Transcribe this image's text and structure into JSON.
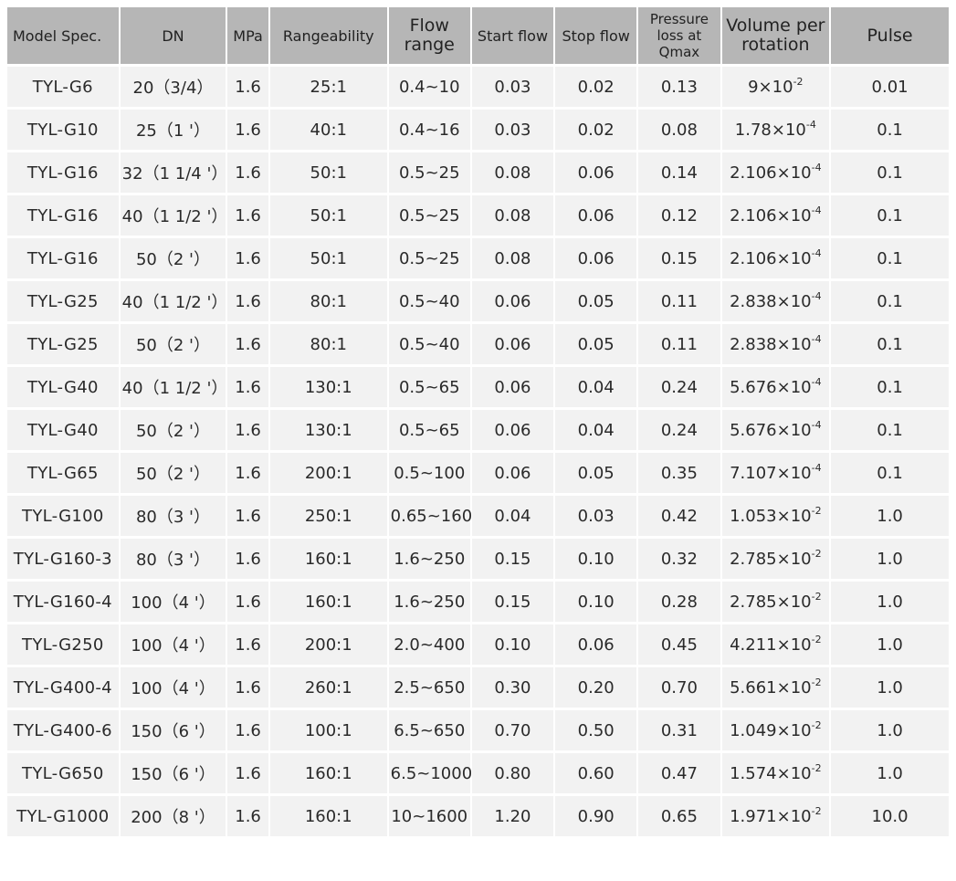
{
  "columns": [
    "Model Spec.",
    "DN",
    "MPa",
    "Rangeability",
    "Flow range",
    "Start flow",
    "Stop flow",
    "Pressure loss at Qmax",
    "Volume per rotation",
    "Pulse"
  ],
  "rows": [
    {
      "model": "TYL-G6",
      "dn": "20（3/4）",
      "mpa": "1.6",
      "range": "25:1",
      "flow": "0.4~10",
      "start": "0.03",
      "stop": "0.02",
      "loss": "0.13",
      "vol": "9×10",
      "exp": "-2",
      "pulse": "0.01"
    },
    {
      "model": "TYL-G10",
      "dn": "25（1 '）",
      "mpa": "1.6",
      "range": "40:1",
      "flow": "0.4~16",
      "start": "0.03",
      "stop": "0.02",
      "loss": "0.08",
      "vol": "1.78×10",
      "exp": "-4",
      "pulse": "0.1"
    },
    {
      "model": "TYL-G16",
      "dn": "32（1 1/4 '）",
      "mpa": "1.6",
      "range": "50:1",
      "flow": "0.5~25",
      "start": "0.08",
      "stop": "0.06",
      "loss": "0.14",
      "vol": "2.106×10",
      "exp": "-4",
      "pulse": "0.1"
    },
    {
      "model": "TYL-G16",
      "dn": "40（1 1/2 '）",
      "mpa": "1.6",
      "range": "50:1",
      "flow": "0.5~25",
      "start": "0.08",
      "stop": "0.06",
      "loss": "0.12",
      "vol": "2.106×10",
      "exp": "-4",
      "pulse": "0.1"
    },
    {
      "model": "TYL-G16",
      "dn": "50（2 '）",
      "mpa": "1.6",
      "range": "50:1",
      "flow": "0.5~25",
      "start": "0.08",
      "stop": "0.06",
      "loss": "0.15",
      "vol": "2.106×10",
      "exp": "-4",
      "pulse": "0.1"
    },
    {
      "model": "TYL-G25",
      "dn": "40（1 1/2 '）",
      "mpa": "1.6",
      "range": "80:1",
      "flow": "0.5~40",
      "start": "0.06",
      "stop": "0.05",
      "loss": "0.11",
      "vol": "2.838×10",
      "exp": "-4",
      "pulse": "0.1"
    },
    {
      "model": "TYL-G25",
      "dn": "50（2 '）",
      "mpa": "1.6",
      "range": "80:1",
      "flow": "0.5~40",
      "start": "0.06",
      "stop": "0.05",
      "loss": "0.11",
      "vol": "2.838×10",
      "exp": "-4",
      "pulse": "0.1"
    },
    {
      "model": "TYL-G40",
      "dn": "40（1 1/2 '）",
      "mpa": "1.6",
      "range": "130:1",
      "flow": "0.5~65",
      "start": "0.06",
      "stop": "0.04",
      "loss": "0.24",
      "vol": "5.676×10",
      "exp": "-4",
      "pulse": "0.1"
    },
    {
      "model": "TYL-G40",
      "dn": "50（2 '）",
      "mpa": "1.6",
      "range": "130:1",
      "flow": "0.5~65",
      "start": "0.06",
      "stop": "0.04",
      "loss": "0.24",
      "vol": "5.676×10",
      "exp": "-4",
      "pulse": "0.1"
    },
    {
      "model": "TYL-G65",
      "dn": "50（2 '）",
      "mpa": "1.6",
      "range": "200:1",
      "flow": "0.5~100",
      "start": "0.06",
      "stop": "0.05",
      "loss": "0.35",
      "vol": "7.107×10",
      "exp": "-4",
      "pulse": "0.1"
    },
    {
      "model": "TYL-G100",
      "dn": "80（3 '）",
      "mpa": "1.6",
      "range": "250:1",
      "flow": "0.65~160",
      "start": "0.04",
      "stop": "0.03",
      "loss": "0.42",
      "vol": "1.053×10",
      "exp": "-2",
      "pulse": "1.0"
    },
    {
      "model": "TYL-G160-3",
      "dn": "80（3 '）",
      "mpa": "1.6",
      "range": "160:1",
      "flow": "1.6~250",
      "start": "0.15",
      "stop": "0.10",
      "loss": "0.32",
      "vol": "2.785×10",
      "exp": "-2",
      "pulse": "1.0"
    },
    {
      "model": "TYL-G160-4",
      "dn": "100（4 '）",
      "mpa": "1.6",
      "range": "160:1",
      "flow": "1.6~250",
      "start": "0.15",
      "stop": "0.10",
      "loss": "0.28",
      "vol": "2.785×10",
      "exp": "-2",
      "pulse": "1.0"
    },
    {
      "model": "TYL-G250",
      "dn": "100（4 '）",
      "mpa": "1.6",
      "range": "200:1",
      "flow": "2.0~400",
      "start": "0.10",
      "stop": "0.06",
      "loss": "0.45",
      "vol": "4.211×10",
      "exp": "-2",
      "pulse": "1.0"
    },
    {
      "model": "TYL-G400-4",
      "dn": "100（4 '）",
      "mpa": "1.6",
      "range": "260:1",
      "flow": "2.5~650",
      "start": "0.30",
      "stop": "0.20",
      "loss": "0.70",
      "vol": "5.661×10",
      "exp": "-2",
      "pulse": "1.0"
    },
    {
      "model": "TYL-G400-6",
      "dn": "150（6 '）",
      "mpa": "1.6",
      "range": "100:1",
      "flow": "6.5~650",
      "start": "0.70",
      "stop": "0.50",
      "loss": "0.31",
      "vol": "1.049×10",
      "exp": "-2",
      "pulse": "1.0"
    },
    {
      "model": "TYL-G650",
      "dn": "150（6 '）",
      "mpa": "1.6",
      "range": "160:1",
      "flow": "6.5~1000",
      "start": "0.80",
      "stop": "0.60",
      "loss": "0.47",
      "vol": "1.574×10",
      "exp": "-2",
      "pulse": "1.0"
    },
    {
      "model": "TYL-G1000",
      "dn": "200（8 '）",
      "mpa": "1.6",
      "range": "160:1",
      "flow": "10~1600",
      "start": "1.20",
      "stop": "0.90",
      "loss": "0.65",
      "vol": "1.971×10",
      "exp": "-2",
      "pulse": "10.0"
    }
  ]
}
